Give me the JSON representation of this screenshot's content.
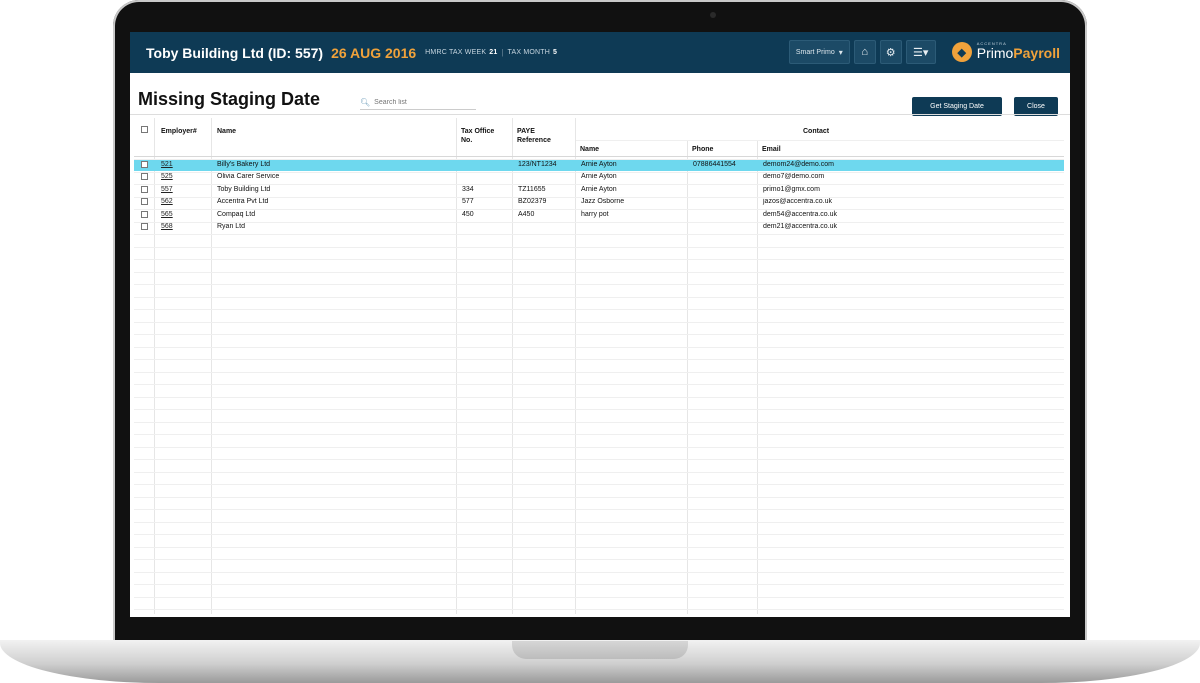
{
  "header": {
    "company": "Toby Building Ltd (ID: 557)",
    "date": "26 AUG 2016",
    "tax_week_label": "HMRC TAX WEEK",
    "tax_week_value": "21",
    "tax_month_label": "TAX MONTH",
    "tax_month_value": "5",
    "dropdown_label": "Smart Primo",
    "logo_small": "ACCENTRA",
    "logo_primo": "Primo",
    "logo_payroll": "Payroll"
  },
  "page": {
    "title": "Missing Staging Date",
    "search_placeholder": "Search list",
    "get_button": "Get Staging Date",
    "close_button": "Close"
  },
  "table": {
    "headers": {
      "employer": "Employer#",
      "name": "Name",
      "tax_office_1": "Tax Office",
      "tax_office_2": "No.",
      "paye_1": "PAYE",
      "paye_2": "Reference",
      "contact": "Contact",
      "contact_name": "Name",
      "phone": "Phone",
      "email": "Email"
    },
    "rows": [
      {
        "employer": "521",
        "name": "Billy's Bakery Ltd",
        "tax_office": "",
        "paye": "123/NT1234",
        "contact_name": "Arnie Ayton",
        "phone": "07886441554",
        "email": "demom24@demo.com",
        "selected": true
      },
      {
        "employer": "525",
        "name": "Olivia Carer Service",
        "tax_office": "",
        "paye": "",
        "contact_name": "Arnie Ayton",
        "phone": "",
        "email": "demo7@demo.com",
        "selected": false
      },
      {
        "employer": "557",
        "name": "Toby Building Ltd",
        "tax_office": "334",
        "paye": "TZ11655",
        "contact_name": "Arnie Ayton",
        "phone": "",
        "email": "primo1@gmx.com",
        "selected": false
      },
      {
        "employer": "562",
        "name": "Accentra Pvt Ltd",
        "tax_office": "577",
        "paye": "BZ02379",
        "contact_name": "Jazz Osborne",
        "phone": "",
        "email": "jazos@accentra.co.uk",
        "selected": false
      },
      {
        "employer": "565",
        "name": "Compaq Ltd",
        "tax_office": "450",
        "paye": "A450",
        "contact_name": "harry pot",
        "phone": "",
        "email": "dem54@accentra.co.uk",
        "selected": false
      },
      {
        "employer": "568",
        "name": "Ryan Ltd",
        "tax_office": "",
        "paye": "",
        "contact_name": "",
        "phone": "",
        "email": "dem21@accentra.co.uk",
        "selected": false
      }
    ]
  },
  "colors": {
    "appbar": "#0e3a55",
    "accent": "#f0a23b",
    "selected_row": "#6ed8ee"
  }
}
